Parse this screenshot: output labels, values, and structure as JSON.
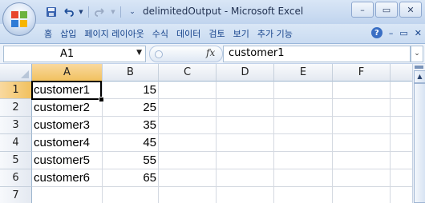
{
  "window": {
    "title": "delimitedOutput - Microsoft Excel",
    "quick_access": {
      "save_icon": "save-icon",
      "undo_icon": "undo-icon",
      "redo_icon": "redo-icon",
      "customize_icon": "customize-qat-icon"
    },
    "controls": {
      "minimize": "–",
      "restore": "▭",
      "close": "✕"
    }
  },
  "ribbon": {
    "tabs": [
      "홈",
      "삽입",
      "페이지 레이아웃",
      "수식",
      "데이터",
      "검토",
      "보기",
      "추가 기능"
    ],
    "help_label": "?",
    "doc_controls": [
      "–",
      "▭",
      "✕"
    ]
  },
  "formula_bar": {
    "name_box": "A1",
    "fx": "fx",
    "content": "customer1"
  },
  "sheet": {
    "columns": [
      "A",
      "B",
      "C",
      "D",
      "E",
      "F"
    ],
    "rows": [
      "1",
      "2",
      "3",
      "4",
      "5",
      "6",
      "7"
    ],
    "data": [
      {
        "a": "customer1",
        "b": "15"
      },
      {
        "a": "customer2",
        "b": "25"
      },
      {
        "a": "customer3",
        "b": "35"
      },
      {
        "a": "customer4",
        "b": "45"
      },
      {
        "a": "customer5",
        "b": "55"
      },
      {
        "a": "customer6",
        "b": "65"
      }
    ],
    "active_cell": "A1"
  },
  "colors": {
    "selected_header": "#f1c15f",
    "ribbon_text": "#15428b"
  }
}
